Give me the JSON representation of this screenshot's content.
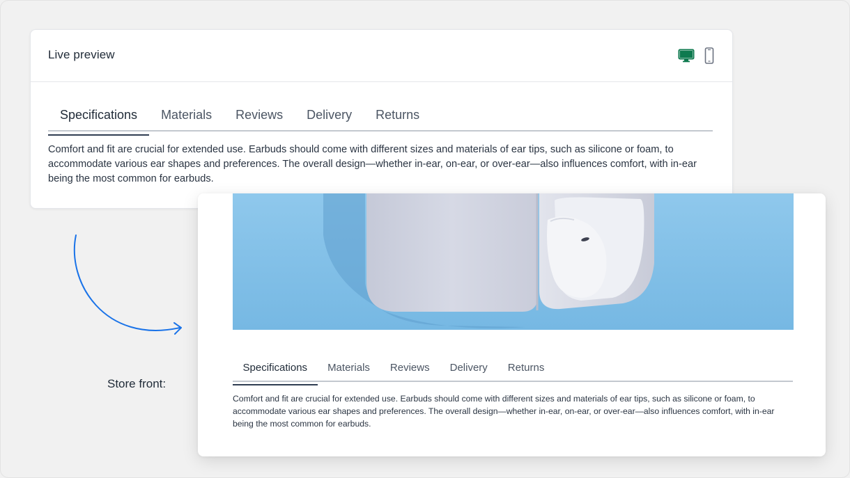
{
  "preview": {
    "title": "Live preview",
    "icons": [
      "desktop-icon",
      "mobile-icon"
    ],
    "active_device_color": "#0f7a4f",
    "tabs": [
      {
        "label": "Specifications",
        "active": true
      },
      {
        "label": "Materials",
        "active": false
      },
      {
        "label": "Reviews",
        "active": false
      },
      {
        "label": "Delivery",
        "active": false
      },
      {
        "label": "Returns",
        "active": false
      }
    ],
    "body": "Comfort and fit are crucial for extended use. Earbuds should come with different sizes and materials of ear tips, such as silicone or foam, to accommodate various ear shapes and preferences. The overall design—whether in-ear, on-ear, or over-ear—also influences comfort, with in-ear being the most common for earbuds."
  },
  "store_front": {
    "label": "Store front:",
    "image": "earbuds-case-photo",
    "tabs": [
      {
        "label": "Specifications",
        "active": true
      },
      {
        "label": "Materials",
        "active": false
      },
      {
        "label": "Reviews",
        "active": false
      },
      {
        "label": "Delivery",
        "active": false
      },
      {
        "label": "Returns",
        "active": false
      }
    ],
    "body": "Comfort and fit are crucial for extended use. Earbuds should come with different sizes and materials of ear tips, such as silicone or foam, to accommodate various ear shapes and preferences. The overall design—whether in-ear, on-ear, or over-ear—also influences comfort, with in-ear being the most common for earbuds."
  },
  "colors": {
    "accent_arrow": "#1a73e8",
    "image_background": "#7fbfe6"
  }
}
